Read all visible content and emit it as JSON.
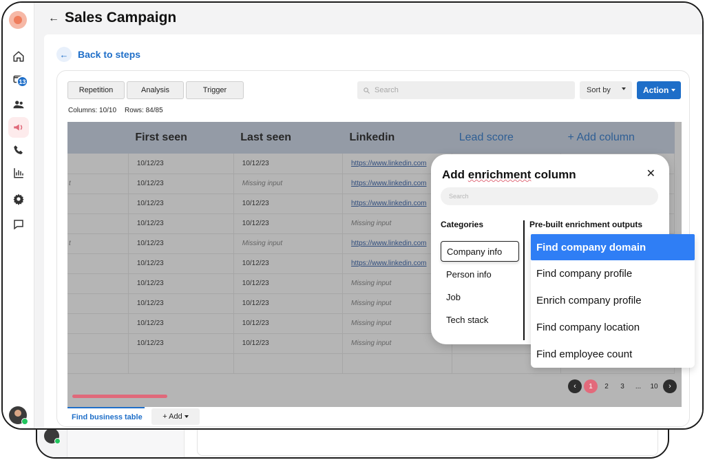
{
  "header": {
    "title": "Sales Campaign",
    "back_icon": "arrow-left-icon"
  },
  "sidebar": {
    "badge_count": "13",
    "items": [
      {
        "name": "home-icon"
      },
      {
        "name": "campaigns-icon"
      },
      {
        "name": "contacts-icon"
      },
      {
        "name": "megaphone-icon"
      },
      {
        "name": "phone-icon"
      },
      {
        "name": "analytics-icon"
      },
      {
        "name": "settings-icon"
      },
      {
        "name": "chat-icon"
      }
    ]
  },
  "nav": {
    "back_to_steps": "Back to steps"
  },
  "toolbar": {
    "tabs": [
      "Repetition",
      "Analysis",
      "Trigger"
    ],
    "search_placeholder": "Search",
    "sort_label": "Sort by",
    "action_label": "Action"
  },
  "stats": {
    "columns": "Columns: 10/10",
    "rows": "Rows: 84/85"
  },
  "table": {
    "headers": [
      "",
      "First seen",
      "Last seen",
      "Linkedin",
      "Lead score",
      "+ Add column"
    ],
    "rows": [
      [
        "",
        "10/12/23",
        "10/12/23",
        "https://www.linkedin.com"
      ],
      [
        "t",
        "10/12/23",
        "Missing input",
        "https://www.linkedin.com"
      ],
      [
        "",
        "10/12/23",
        "10/12/23",
        "https://www.linkedin.com"
      ],
      [
        "",
        "10/12/23",
        "10/12/23",
        "Missing input"
      ],
      [
        "t",
        "10/12/23",
        "Missing input",
        "https://www.linkedin.com"
      ],
      [
        "",
        "10/12/23",
        "10/12/23",
        "https://www.linkedin.com"
      ],
      [
        "",
        "10/12/23",
        "10/12/23",
        "Missing input"
      ],
      [
        "",
        "10/12/23",
        "10/12/23",
        "Missing input"
      ],
      [
        "",
        "10/12/23",
        "10/12/23",
        "Missing input"
      ],
      [
        "",
        "10/12/23",
        "10/12/23",
        "Missing input"
      ]
    ]
  },
  "pagination": {
    "pages": [
      "1",
      "2",
      "3",
      "...",
      "10"
    ],
    "current": "1"
  },
  "bottom_tabs": {
    "find_business_table": "Find business table",
    "add": "+ Add"
  },
  "modal": {
    "title_prefix": "Add ",
    "title_underlined": "enrichment",
    "title_suffix": " column",
    "search_placeholder": "Search",
    "categories_heading": "Categories",
    "outputs_heading": "Pre-built enrichment outputs",
    "categories": [
      "Company info",
      "Person info",
      "Job",
      "Tech stack"
    ],
    "selected_category": "Company info",
    "outputs": [
      "Find company domain",
      "Find company profile",
      "Enrich company profile",
      "Find company location",
      "Find employee count"
    ],
    "active_output": "Find company domain"
  },
  "colors": {
    "accent": "#1e6ec8",
    "highlight": "#2f7ef5",
    "pink": "#e36a7b"
  }
}
